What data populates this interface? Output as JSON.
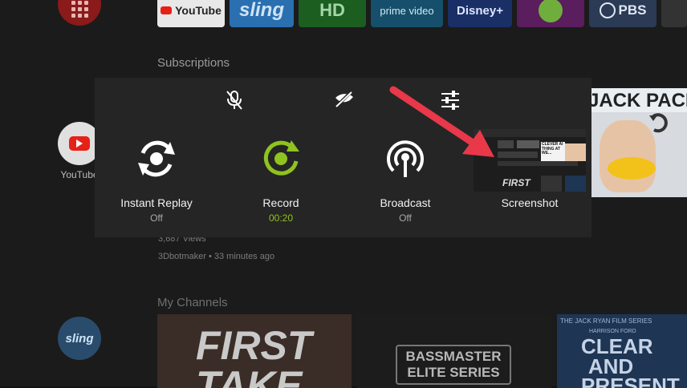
{
  "background": {
    "top_row_tiles": [
      "YouTube",
      "sling",
      "HD",
      "prime video",
      "Disney+",
      "PBS"
    ],
    "subscriptions_label": "Subscriptions",
    "youtube_app_label": "YouTube",
    "video_meta": {
      "views": "3,687 Views",
      "channel_time": "3Dbotmaker • 33 minutes ago"
    },
    "my_channels_label": "My Channels",
    "channel_tiles": [
      "FIRST TAKE",
      "BASSMASTER ELITE SERIES",
      "CLEAR AND PRESENT"
    ],
    "sling_label": "sling",
    "right_thumb_text": "JACK PACI",
    "jack_ryan_caption": "THE JACK RYAN FILM SERIES",
    "harrison_ford": "HARRISON FORD"
  },
  "overlay": {
    "top_icons": [
      "mic-off-icon",
      "camera-off-icon",
      "settings-sliders-icon"
    ],
    "actions": [
      {
        "label": "Instant Replay",
        "status": "Off"
      },
      {
        "label": "Record",
        "status": "00:20"
      },
      {
        "label": "Broadcast",
        "status": "Off"
      }
    ],
    "screenshot": {
      "label": "Screenshot",
      "thumb_text_1": "FIRST",
      "thumb_text_2": "CLEVER AI THING AT WE..."
    }
  },
  "colors": {
    "accent_green": "#8fc31f",
    "arrow_red": "#e8384a",
    "panel_bg": "#252525"
  }
}
